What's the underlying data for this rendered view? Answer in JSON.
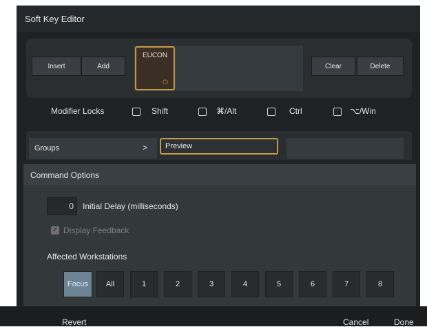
{
  "window": {
    "title": "Soft Key Editor"
  },
  "key_panel": {
    "insert_label": "Insert",
    "add_label": "Add",
    "clear_label": "Clear",
    "delete_label": "Delete",
    "selected_key": {
      "label": "EUCON",
      "icon": "power-icon"
    }
  },
  "modifier_locks": {
    "label": "Modifier Locks",
    "items": [
      {
        "label": "Shift",
        "checked": false
      },
      {
        "label": "⌘/Alt",
        "checked": false
      },
      {
        "label": "Ctrl",
        "checked": false
      },
      {
        "label": "⌥/Win",
        "checked": false
      }
    ]
  },
  "groups": {
    "label": "Groups",
    "chevron": ">",
    "preview_value": "Preview"
  },
  "command_options": {
    "title": "Command Options",
    "initial_delay_value": "0",
    "initial_delay_label": "Initial Delay (milliseconds)",
    "display_feedback_label": "Display Feedback",
    "display_feedback_checked": true,
    "affected_label": "Affected Workstations",
    "workstations": [
      "Focus",
      "All",
      "1",
      "2",
      "3",
      "4",
      "5",
      "6",
      "7",
      "8"
    ],
    "selected_workstation": "Focus"
  },
  "footer": {
    "revert_label": "Revert",
    "cancel_label": "Cancel",
    "done_label": "Done"
  },
  "colors": {
    "accent": "#c99a45",
    "focus_bg": "#6c8494"
  }
}
